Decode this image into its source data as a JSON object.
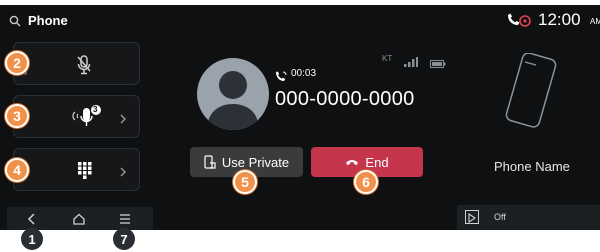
{
  "header": {
    "title": "Phone",
    "time": "12:00",
    "ampm": "AM"
  },
  "status_icons": {
    "carrier": "KT",
    "signal": "signal-bars-icon",
    "battery": "battery-icon"
  },
  "left_buttons": [
    {
      "name": "mute-microphone-button",
      "icon": "microphone-off-icon"
    },
    {
      "name": "microphone-volume-button",
      "icon": "microphone-volume-icon",
      "badge": "3"
    },
    {
      "name": "keypad-button",
      "icon": "keypad-icon"
    }
  ],
  "call": {
    "duration": "00:03",
    "number": "000-0000-0000"
  },
  "actions": {
    "private_label": "Use Private",
    "end_label": "End"
  },
  "device": {
    "name": "Phone Name"
  },
  "media": {
    "label": "Off"
  },
  "callouts": {
    "c1": "1",
    "c2": "2",
    "c3": "3",
    "c4": "4",
    "c5": "5",
    "c6": "6",
    "c7": "7"
  },
  "colors": {
    "background": "#0f1011",
    "end_button": "#c5354c",
    "private_button": "#3a3b3d",
    "callout": "#f0924a",
    "avatar": "#9aa3ab",
    "accent_red": "#e6404e"
  }
}
